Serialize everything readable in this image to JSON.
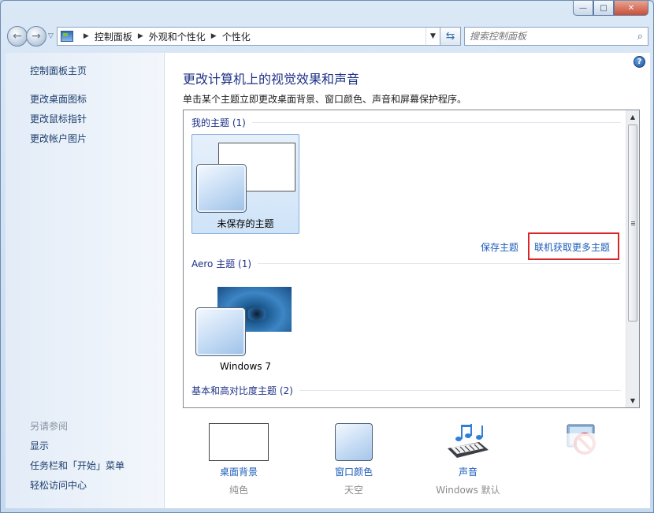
{
  "window": {
    "min_glyph": "—",
    "max_glyph": "□",
    "close_glyph": "✕"
  },
  "nav": {
    "back_glyph": "←",
    "forward_glyph": "→",
    "recent_glyph": "▽",
    "breadcrumb": [
      "控制面板",
      "外观和个性化",
      "个性化"
    ],
    "crumb_sep": "▶",
    "drop_glyph": "▼",
    "refresh_glyph": "⇆",
    "search_placeholder": "搜索控制面板",
    "search_glyph": "⌕"
  },
  "sidebar": {
    "home": "控制面板主页",
    "links": [
      "更改桌面图标",
      "更改鼠标指针",
      "更改帐户图片"
    ],
    "see_also_title": "另请参阅",
    "see_also": [
      "显示",
      "任务栏和「开始」菜单",
      "轻松访问中心"
    ]
  },
  "content": {
    "help_glyph": "?",
    "title": "更改计算机上的视觉效果和声音",
    "description": "单击某个主题立即更改桌面背景、窗口颜色、声音和屏幕保护程序。",
    "groups": {
      "my": "我的主题 (1)",
      "aero": "Aero 主题 (1)",
      "basic": "基本和高对比度主题 (2)"
    },
    "my_themes": [
      {
        "label": "未保存的主题",
        "selected": true
      }
    ],
    "aero_themes": [
      {
        "label": "Windows 7",
        "selected": false
      }
    ],
    "save_theme": "保存主题",
    "get_more": "联机获取更多主题",
    "scroll_up": "▲",
    "scroll_down": "▼",
    "highlight_color": "#d9262b"
  },
  "bottom": {
    "desktop_background": {
      "label": "桌面背景",
      "value": "纯色"
    },
    "window_color": {
      "label": "窗口颜色",
      "value": "天空"
    },
    "sounds": {
      "label": "声音",
      "value": "Windows 默认"
    },
    "screen_saver": {
      "icon": "screen-saver-none-icon"
    }
  }
}
